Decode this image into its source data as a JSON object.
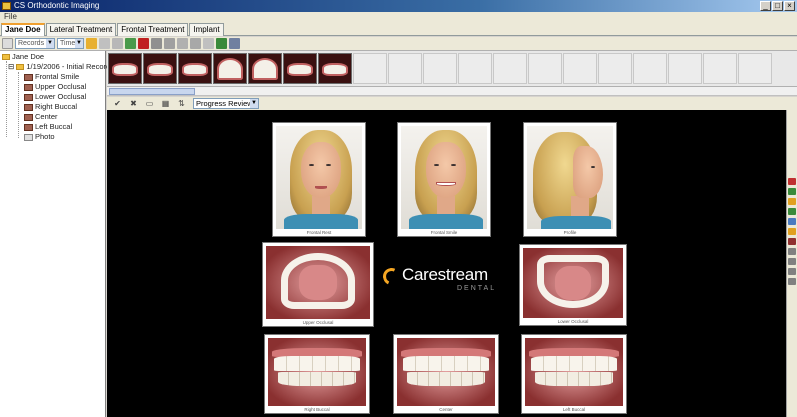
{
  "window": {
    "title": "CS Orthodontic Imaging"
  },
  "menu": {
    "items": [
      "File"
    ]
  },
  "tabs": [
    {
      "label": "Jane Doe",
      "active": true
    },
    {
      "label": "Lateral Treatment",
      "active": false
    },
    {
      "label": "Frontal Treatment",
      "active": false
    },
    {
      "label": "Implant",
      "active": false
    }
  ],
  "toolbar": {
    "records_combo": "Records",
    "timed_combo": "Timed"
  },
  "tree": {
    "root": "Jane Doe",
    "session": "1/19/2006 - Initial Records",
    "items": [
      "Frontal Smile",
      "Upper Occlusal",
      "Lower Occlusal",
      "Right Buccal",
      "Center",
      "Left Buccal",
      "Photo"
    ]
  },
  "viewbar": {
    "template": "Progress Review"
  },
  "photos": {
    "row1": [
      "Frontal Rest",
      "Frontal Smile",
      "Profile"
    ],
    "row2": [
      "Upper Occlusal",
      "Lower Occlusal"
    ],
    "row3": [
      "Right Buccal",
      "Center",
      "Left Buccal"
    ]
  },
  "logo": {
    "name": "Carestream",
    "sub": "DENTAL"
  },
  "colors": {
    "accent": "#f5a623",
    "canvas": "#000000"
  }
}
